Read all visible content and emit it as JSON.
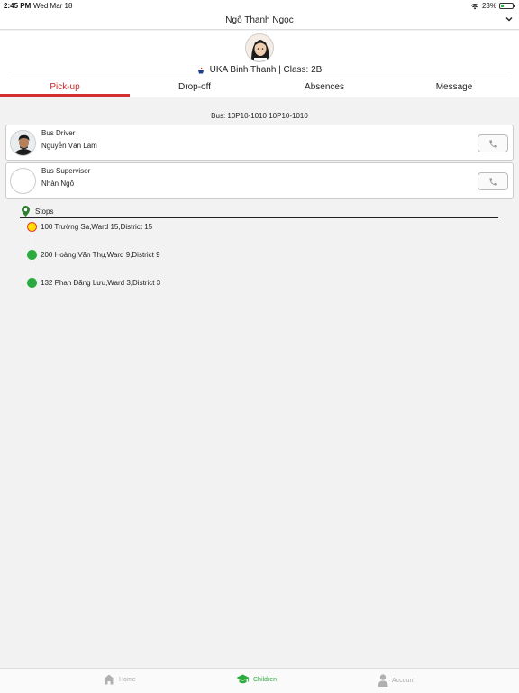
{
  "status_bar": {
    "time": "2:45 PM",
    "date": "Wed Mar 18",
    "battery": "23%"
  },
  "header": {
    "title": "Ngô Thanh Ngọc"
  },
  "profile": {
    "school_class": "UKA Binh Thanh | Class: 2B"
  },
  "tabs": [
    {
      "label": "Pick-up",
      "active": true
    },
    {
      "label": "Drop-off",
      "active": false
    },
    {
      "label": "Absences",
      "active": false
    },
    {
      "label": "Message",
      "active": false
    }
  ],
  "bus": {
    "label": "Bus: 10P10-1010 10P10-1010"
  },
  "driver": {
    "role": "Bus Driver",
    "name": "Nguyễn Văn Lâm"
  },
  "supervisor": {
    "role": "Bus Supervisor",
    "name": "Nhàn Ngô"
  },
  "stops": {
    "title": "Stops",
    "items": [
      {
        "address": "100 Trường Sa,Ward 15,District 15",
        "current": true
      },
      {
        "address": "200 Hoàng Văn Thụ,Ward 9,District 9",
        "current": false
      },
      {
        "address": "132 Phan Đăng Lưu,Ward 3,District 3",
        "current": false
      }
    ]
  },
  "bottom_nav": [
    {
      "label": "Home",
      "icon": "home-icon",
      "active": false
    },
    {
      "label": "Children",
      "icon": "graduation-cap-icon",
      "active": true
    },
    {
      "label": "Account",
      "icon": "person-icon",
      "active": false
    }
  ],
  "colors": {
    "accent": "#d32f2f",
    "green": "#2bab3e",
    "current_stop": "#ffe000"
  }
}
